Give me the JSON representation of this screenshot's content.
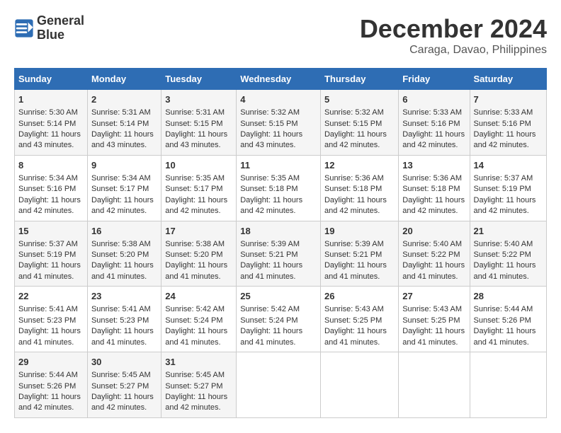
{
  "header": {
    "logo_line1": "General",
    "logo_line2": "Blue",
    "title": "December 2024",
    "subtitle": "Caraga, Davao, Philippines"
  },
  "calendar": {
    "days_of_week": [
      "Sunday",
      "Monday",
      "Tuesday",
      "Wednesday",
      "Thursday",
      "Friday",
      "Saturday"
    ],
    "weeks": [
      [
        {
          "day": "",
          "info": ""
        },
        {
          "day": "",
          "info": ""
        },
        {
          "day": "",
          "info": ""
        },
        {
          "day": "",
          "info": ""
        },
        {
          "day": "",
          "info": ""
        },
        {
          "day": "",
          "info": ""
        },
        {
          "day": "",
          "info": ""
        }
      ]
    ],
    "cells": [
      [
        {
          "day": "1",
          "rise": "Sunrise: 5:30 AM",
          "set": "Sunset: 5:14 PM",
          "daylight": "Daylight: 11 hours and 43 minutes."
        },
        {
          "day": "2",
          "rise": "Sunrise: 5:31 AM",
          "set": "Sunset: 5:14 PM",
          "daylight": "Daylight: 11 hours and 43 minutes."
        },
        {
          "day": "3",
          "rise": "Sunrise: 5:31 AM",
          "set": "Sunset: 5:15 PM",
          "daylight": "Daylight: 11 hours and 43 minutes."
        },
        {
          "day": "4",
          "rise": "Sunrise: 5:32 AM",
          "set": "Sunset: 5:15 PM",
          "daylight": "Daylight: 11 hours and 43 minutes."
        },
        {
          "day": "5",
          "rise": "Sunrise: 5:32 AM",
          "set": "Sunset: 5:15 PM",
          "daylight": "Daylight: 11 hours and 42 minutes."
        },
        {
          "day": "6",
          "rise": "Sunrise: 5:33 AM",
          "set": "Sunset: 5:16 PM",
          "daylight": "Daylight: 11 hours and 42 minutes."
        },
        {
          "day": "7",
          "rise": "Sunrise: 5:33 AM",
          "set": "Sunset: 5:16 PM",
          "daylight": "Daylight: 11 hours and 42 minutes."
        }
      ],
      [
        {
          "day": "8",
          "rise": "Sunrise: 5:34 AM",
          "set": "Sunset: 5:16 PM",
          "daylight": "Daylight: 11 hours and 42 minutes."
        },
        {
          "day": "9",
          "rise": "Sunrise: 5:34 AM",
          "set": "Sunset: 5:17 PM",
          "daylight": "Daylight: 11 hours and 42 minutes."
        },
        {
          "day": "10",
          "rise": "Sunrise: 5:35 AM",
          "set": "Sunset: 5:17 PM",
          "daylight": "Daylight: 11 hours and 42 minutes."
        },
        {
          "day": "11",
          "rise": "Sunrise: 5:35 AM",
          "set": "Sunset: 5:18 PM",
          "daylight": "Daylight: 11 hours and 42 minutes."
        },
        {
          "day": "12",
          "rise": "Sunrise: 5:36 AM",
          "set": "Sunset: 5:18 PM",
          "daylight": "Daylight: 11 hours and 42 minutes."
        },
        {
          "day": "13",
          "rise": "Sunrise: 5:36 AM",
          "set": "Sunset: 5:18 PM",
          "daylight": "Daylight: 11 hours and 42 minutes."
        },
        {
          "day": "14",
          "rise": "Sunrise: 5:37 AM",
          "set": "Sunset: 5:19 PM",
          "daylight": "Daylight: 11 hours and 42 minutes."
        }
      ],
      [
        {
          "day": "15",
          "rise": "Sunrise: 5:37 AM",
          "set": "Sunset: 5:19 PM",
          "daylight": "Daylight: 11 hours and 41 minutes."
        },
        {
          "day": "16",
          "rise": "Sunrise: 5:38 AM",
          "set": "Sunset: 5:20 PM",
          "daylight": "Daylight: 11 hours and 41 minutes."
        },
        {
          "day": "17",
          "rise": "Sunrise: 5:38 AM",
          "set": "Sunset: 5:20 PM",
          "daylight": "Daylight: 11 hours and 41 minutes."
        },
        {
          "day": "18",
          "rise": "Sunrise: 5:39 AM",
          "set": "Sunset: 5:21 PM",
          "daylight": "Daylight: 11 hours and 41 minutes."
        },
        {
          "day": "19",
          "rise": "Sunrise: 5:39 AM",
          "set": "Sunset: 5:21 PM",
          "daylight": "Daylight: 11 hours and 41 minutes."
        },
        {
          "day": "20",
          "rise": "Sunrise: 5:40 AM",
          "set": "Sunset: 5:22 PM",
          "daylight": "Daylight: 11 hours and 41 minutes."
        },
        {
          "day": "21",
          "rise": "Sunrise: 5:40 AM",
          "set": "Sunset: 5:22 PM",
          "daylight": "Daylight: 11 hours and 41 minutes."
        }
      ],
      [
        {
          "day": "22",
          "rise": "Sunrise: 5:41 AM",
          "set": "Sunset: 5:23 PM",
          "daylight": "Daylight: 11 hours and 41 minutes."
        },
        {
          "day": "23",
          "rise": "Sunrise: 5:41 AM",
          "set": "Sunset: 5:23 PM",
          "daylight": "Daylight: 11 hours and 41 minutes."
        },
        {
          "day": "24",
          "rise": "Sunrise: 5:42 AM",
          "set": "Sunset: 5:24 PM",
          "daylight": "Daylight: 11 hours and 41 minutes."
        },
        {
          "day": "25",
          "rise": "Sunrise: 5:42 AM",
          "set": "Sunset: 5:24 PM",
          "daylight": "Daylight: 11 hours and 41 minutes."
        },
        {
          "day": "26",
          "rise": "Sunrise: 5:43 AM",
          "set": "Sunset: 5:25 PM",
          "daylight": "Daylight: 11 hours and 41 minutes."
        },
        {
          "day": "27",
          "rise": "Sunrise: 5:43 AM",
          "set": "Sunset: 5:25 PM",
          "daylight": "Daylight: 11 hours and 41 minutes."
        },
        {
          "day": "28",
          "rise": "Sunrise: 5:44 AM",
          "set": "Sunset: 5:26 PM",
          "daylight": "Daylight: 11 hours and 41 minutes."
        }
      ],
      [
        {
          "day": "29",
          "rise": "Sunrise: 5:44 AM",
          "set": "Sunset: 5:26 PM",
          "daylight": "Daylight: 11 hours and 42 minutes."
        },
        {
          "day": "30",
          "rise": "Sunrise: 5:45 AM",
          "set": "Sunset: 5:27 PM",
          "daylight": "Daylight: 11 hours and 42 minutes."
        },
        {
          "day": "31",
          "rise": "Sunrise: 5:45 AM",
          "set": "Sunset: 5:27 PM",
          "daylight": "Daylight: 11 hours and 42 minutes."
        },
        {
          "day": "",
          "rise": "",
          "set": "",
          "daylight": ""
        },
        {
          "day": "",
          "rise": "",
          "set": "",
          "daylight": ""
        },
        {
          "day": "",
          "rise": "",
          "set": "",
          "daylight": ""
        },
        {
          "day": "",
          "rise": "",
          "set": "",
          "daylight": ""
        }
      ]
    ]
  }
}
